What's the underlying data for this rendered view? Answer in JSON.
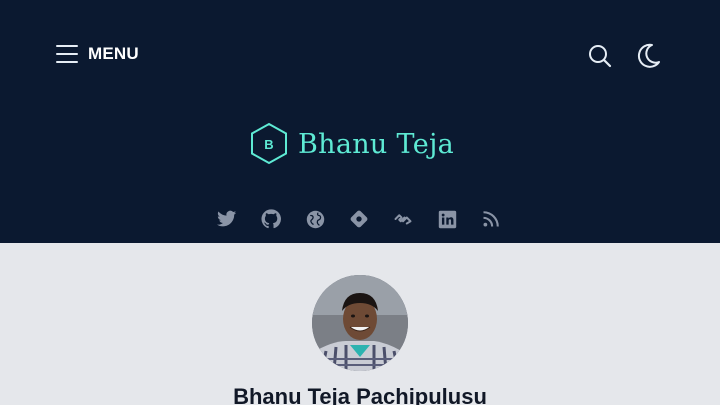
{
  "header": {
    "menu_label": "MENU",
    "site_title": "Bhanu Teja",
    "logo_letter": "B",
    "accent_color": "#5eead4",
    "background_color": "#0b1930",
    "icons": [
      "menu-icon",
      "search-icon",
      "moon-icon"
    ]
  },
  "social_links": [
    {
      "name": "twitter-icon"
    },
    {
      "name": "github-icon"
    },
    {
      "name": "globe-icon"
    },
    {
      "name": "location-icon"
    },
    {
      "name": "dev-icon"
    },
    {
      "name": "linkedin-icon"
    },
    {
      "name": "rss-icon"
    }
  ],
  "author": {
    "name": "Bhanu Teja Pachipulusu"
  }
}
